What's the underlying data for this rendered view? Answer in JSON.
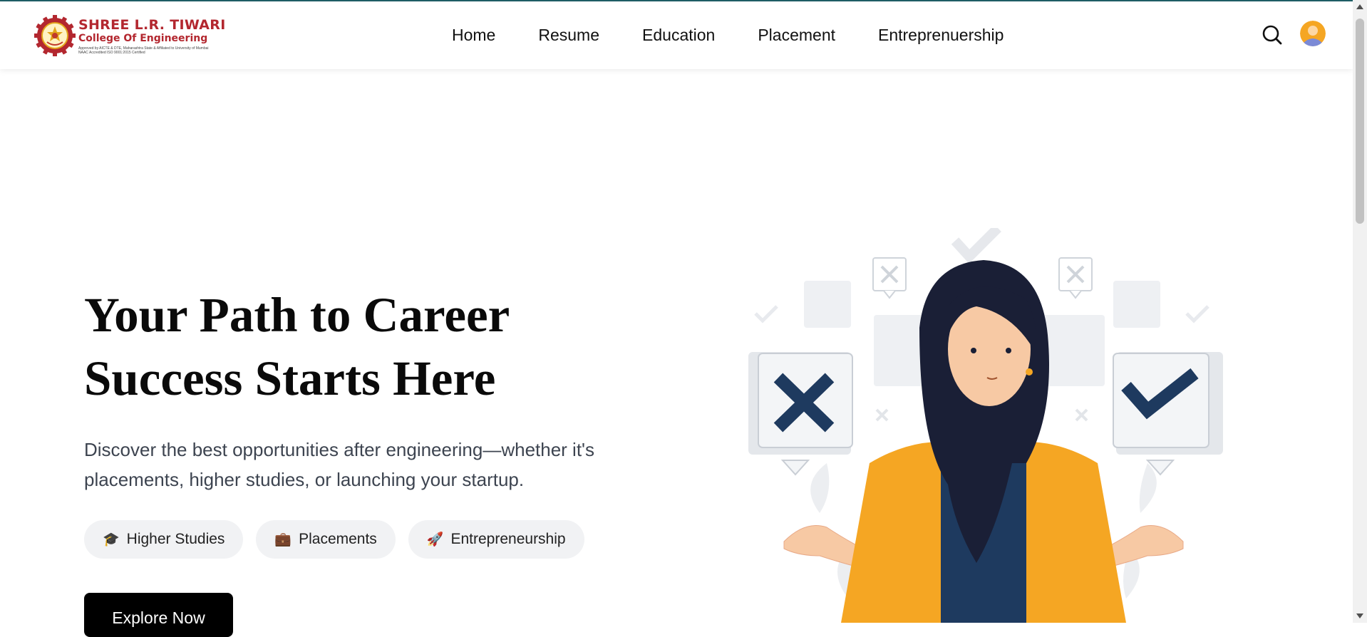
{
  "brand": {
    "line1": "SHREE L.R. TIWARI",
    "line2": "College Of Engineering",
    "tagline1": "Approved by AICTE & DTE, Maharashtra State & Affiliated to University of Mumbai",
    "tagline2": "NAAC Accredited ISO 9001:2015 Certified",
    "color": "#b3272f"
  },
  "nav": {
    "items": [
      {
        "label": "Home"
      },
      {
        "label": "Resume"
      },
      {
        "label": "Education"
      },
      {
        "label": "Placement"
      },
      {
        "label": "Entreprenuership"
      }
    ],
    "search_icon": "search-icon",
    "avatar_icon": "user-avatar"
  },
  "hero": {
    "title_line1": "Your Path to Career",
    "title_line2": "Success Starts Here",
    "subtitle_line1": "Discover the best opportunities after engineering—whether it's",
    "subtitle_line2": "placements, higher studies, or launching your startup.",
    "chips": [
      {
        "icon": "🎓",
        "icon_name": "graduation-cap-icon",
        "label": "Higher Studies"
      },
      {
        "icon": "💼",
        "icon_name": "briefcase-icon",
        "label": "Placements"
      },
      {
        "icon": "🚀",
        "icon_name": "rocket-icon",
        "label": "Entrepreneurship"
      }
    ],
    "cta_label": "Explore Now"
  },
  "colors": {
    "accent_dark": "#000000",
    "illustration_navy": "#1e3a5f",
    "illustration_orange": "#f5a623"
  }
}
